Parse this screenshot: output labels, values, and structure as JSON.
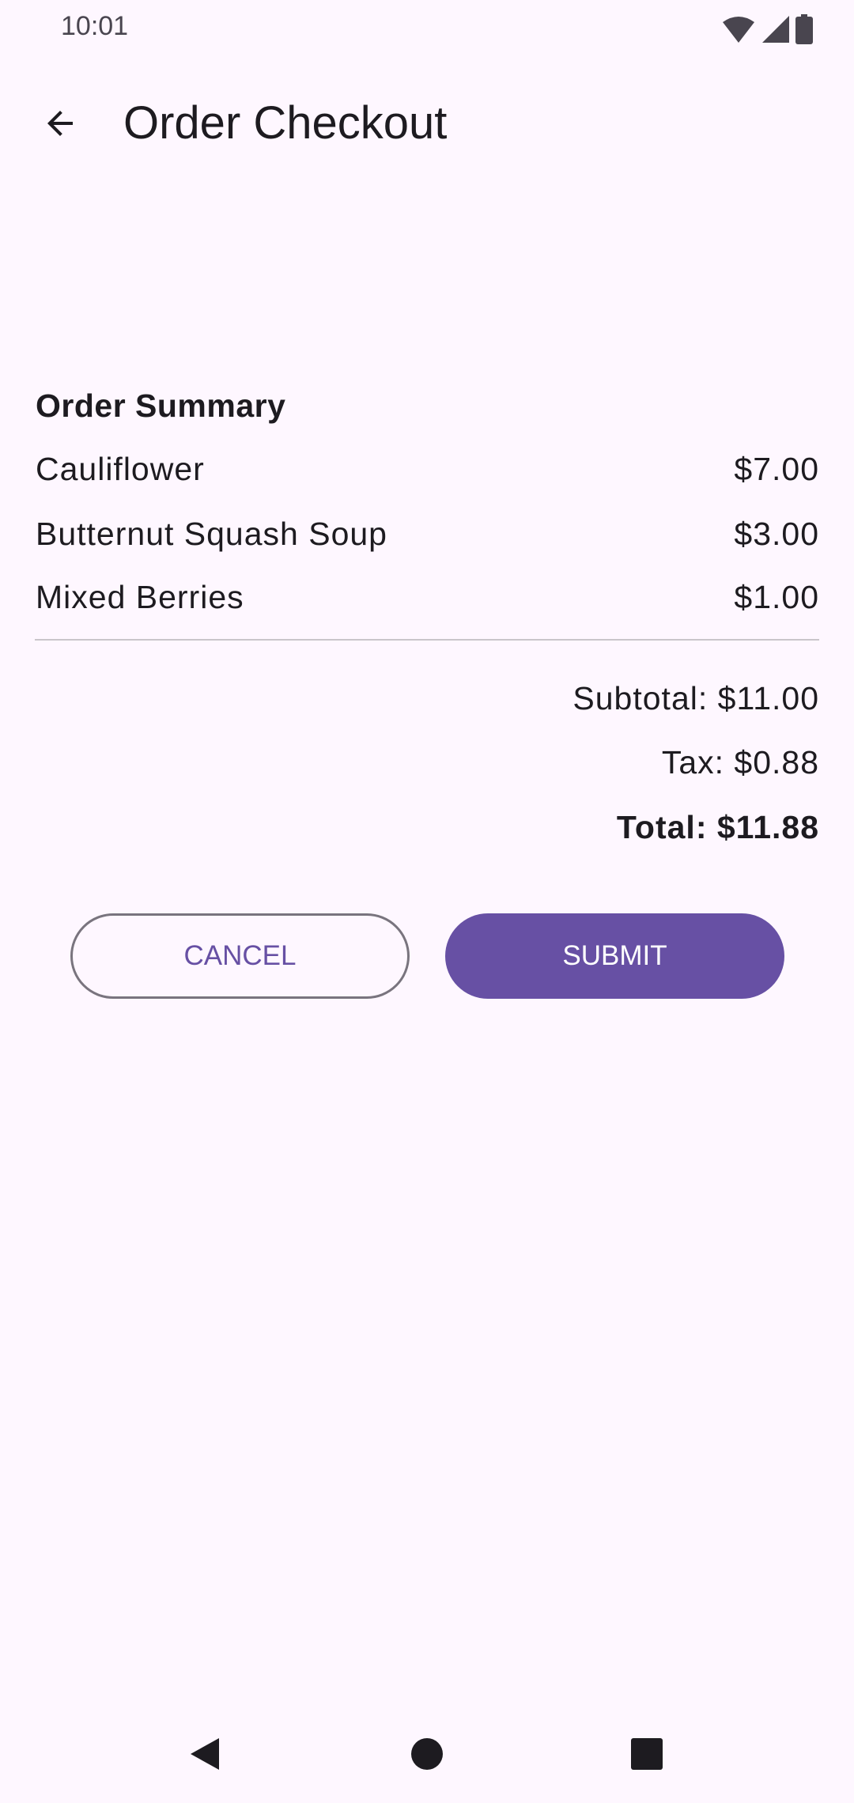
{
  "status_bar": {
    "time": "10:01",
    "icons": [
      "wifi-icon",
      "signal-icon",
      "battery-icon"
    ]
  },
  "app_bar": {
    "title": "Order Checkout",
    "back_icon": "arrow-back-icon"
  },
  "summary": {
    "title": "Order Summary",
    "items": [
      {
        "name": "Cauliflower",
        "price": "$7.00"
      },
      {
        "name": "Butternut Squash Soup",
        "price": "$3.00"
      },
      {
        "name": "Mixed Berries",
        "price": "$1.00"
      }
    ],
    "subtotal": "Subtotal: $11.00",
    "tax": "Tax: $0.88",
    "total": "Total: $11.88"
  },
  "actions": {
    "cancel": "CANCEL",
    "submit": "SUBMIT"
  },
  "colors": {
    "primary": "#6750a4",
    "background": "#fef7ff",
    "outline": "#79747e"
  },
  "nav_bar": {
    "icons": [
      "back-triangle-icon",
      "home-circle-icon",
      "recents-square-icon"
    ]
  }
}
